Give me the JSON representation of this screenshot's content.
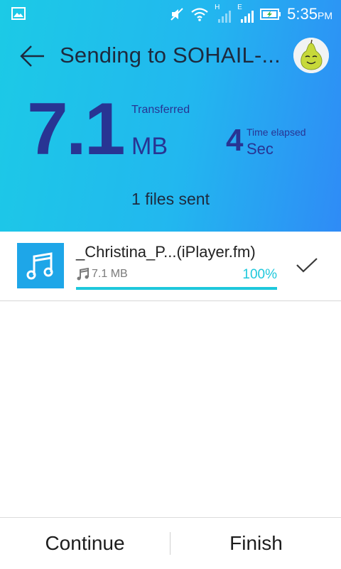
{
  "status_bar": {
    "time": "5:35",
    "ampm": "PM",
    "network_label_1": "H",
    "network_label_2": "E",
    "icons": [
      "image-icon",
      "mute-icon",
      "wifi-icon",
      "signal-icon",
      "signal-icon",
      "battery-charging-icon"
    ]
  },
  "header": {
    "title": "Sending to SOHAIL-...",
    "transferred_value": "7.1",
    "transferred_label": "Transferred",
    "transferred_unit": "MB",
    "elapsed_value": "4",
    "elapsed_label": "Time elapsed",
    "elapsed_unit": "Sec",
    "files_sent": "1 files sent"
  },
  "file": {
    "name": "_Christina_P...(iPlayer.fm)",
    "size": "7.1 MB",
    "percent_label": "100%",
    "progress": 1.0,
    "type_icon": "music-note-icon",
    "status_icon": "check-icon"
  },
  "footer": {
    "continue_label": "Continue",
    "finish_label": "Finish"
  },
  "colors": {
    "header_start": "#1ccae6",
    "header_end": "#2f8bf6",
    "accent_dark": "#283493",
    "progress": "#1ec8dc",
    "file_icon_bg": "#1ea6e8"
  }
}
